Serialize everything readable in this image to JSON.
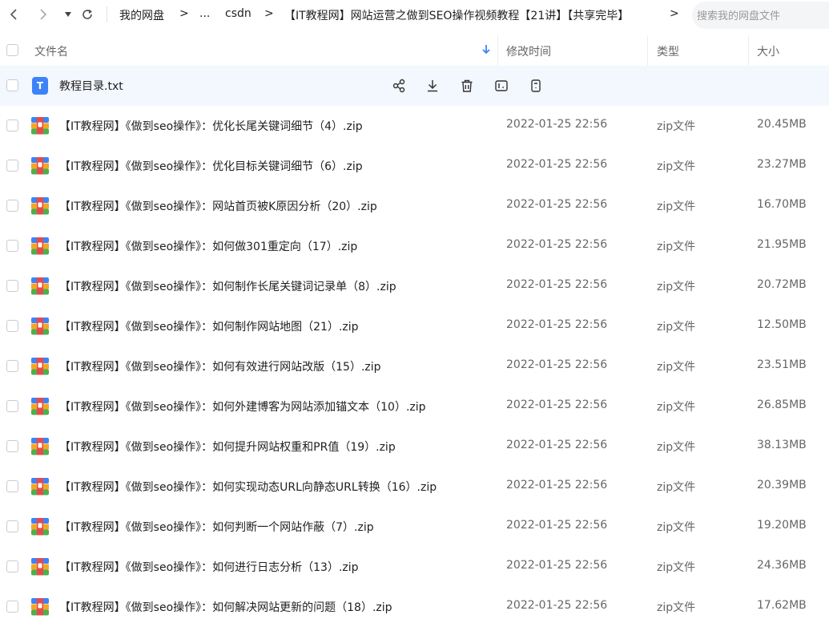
{
  "nav": {
    "breadcrumb": [
      "我的网盘",
      "...",
      "csdn",
      "【IT教程网】网站运营之做到SEO操作视频教程【21讲】【共享完毕】"
    ],
    "separator": ">",
    "search_placeholder": "搜索我的网盘文件"
  },
  "columns": {
    "name": "文件名",
    "modified": "修改时间",
    "type": "类型",
    "size": "大小"
  },
  "colors": {
    "accent": "#3d83f7",
    "selected_row": "#f3f7fe"
  },
  "selected_file": {
    "name": "教程目录.txt",
    "icon": "txt-file-icon",
    "actions": [
      "share-icon",
      "download-icon",
      "delete-icon",
      "rename-icon",
      "more-icon"
    ]
  },
  "files": [
    {
      "name": "【IT教程网】《做到seo操作》：优化长尾关键词细节（4）.zip",
      "date": "2022-01-25 22:56",
      "type": "zip文件",
      "size": "20.45MB"
    },
    {
      "name": "【IT教程网】《做到seo操作》：优化目标关键词细节（6）.zip",
      "date": "2022-01-25 22:56",
      "type": "zip文件",
      "size": "23.27MB"
    },
    {
      "name": "【IT教程网】《做到seo操作》：网站首页被K原因分析（20）.zip",
      "date": "2022-01-25 22:56",
      "type": "zip文件",
      "size": "16.70MB"
    },
    {
      "name": "【IT教程网】《做到seo操作》：如何做301重定向（17）.zip",
      "date": "2022-01-25 22:56",
      "type": "zip文件",
      "size": "21.95MB"
    },
    {
      "name": "【IT教程网】《做到seo操作》：如何制作长尾关键词记录单（8）.zip",
      "date": "2022-01-25 22:56",
      "type": "zip文件",
      "size": "20.72MB"
    },
    {
      "name": "【IT教程网】《做到seo操作》：如何制作网站地图（21）.zip",
      "date": "2022-01-25 22:56",
      "type": "zip文件",
      "size": "12.50MB"
    },
    {
      "name": "【IT教程网】《做到seo操作》：如何有效进行网站改版（15）.zip",
      "date": "2022-01-25 22:56",
      "type": "zip文件",
      "size": "23.51MB"
    },
    {
      "name": "【IT教程网】《做到seo操作》：如何外建博客为网站添加锚文本（10）.zip",
      "date": "2022-01-25 22:56",
      "type": "zip文件",
      "size": "26.85MB"
    },
    {
      "name": "【IT教程网】《做到seo操作》：如何提升网站权重和PR值（19）.zip",
      "date": "2022-01-25 22:56",
      "type": "zip文件",
      "size": "38.13MB"
    },
    {
      "name": "【IT教程网】《做到seo操作》：如何实现动态URL向静态URL转换（16）.zip",
      "date": "2022-01-25 22:56",
      "type": "zip文件",
      "size": "20.39MB"
    },
    {
      "name": "【IT教程网】《做到seo操作》：如何判断一个网站作蔽（7）.zip",
      "date": "2022-01-25 22:56",
      "type": "zip文件",
      "size": "19.20MB"
    },
    {
      "name": "【IT教程网】《做到seo操作》：如何进行日志分析（13）.zip",
      "date": "2022-01-25 22:56",
      "type": "zip文件",
      "size": "24.36MB"
    },
    {
      "name": "【IT教程网】《做到seo操作》：如何解决网站更新的问题（18）.zip",
      "date": "2022-01-25 22:56",
      "type": "zip文件",
      "size": "17.62MB"
    }
  ]
}
